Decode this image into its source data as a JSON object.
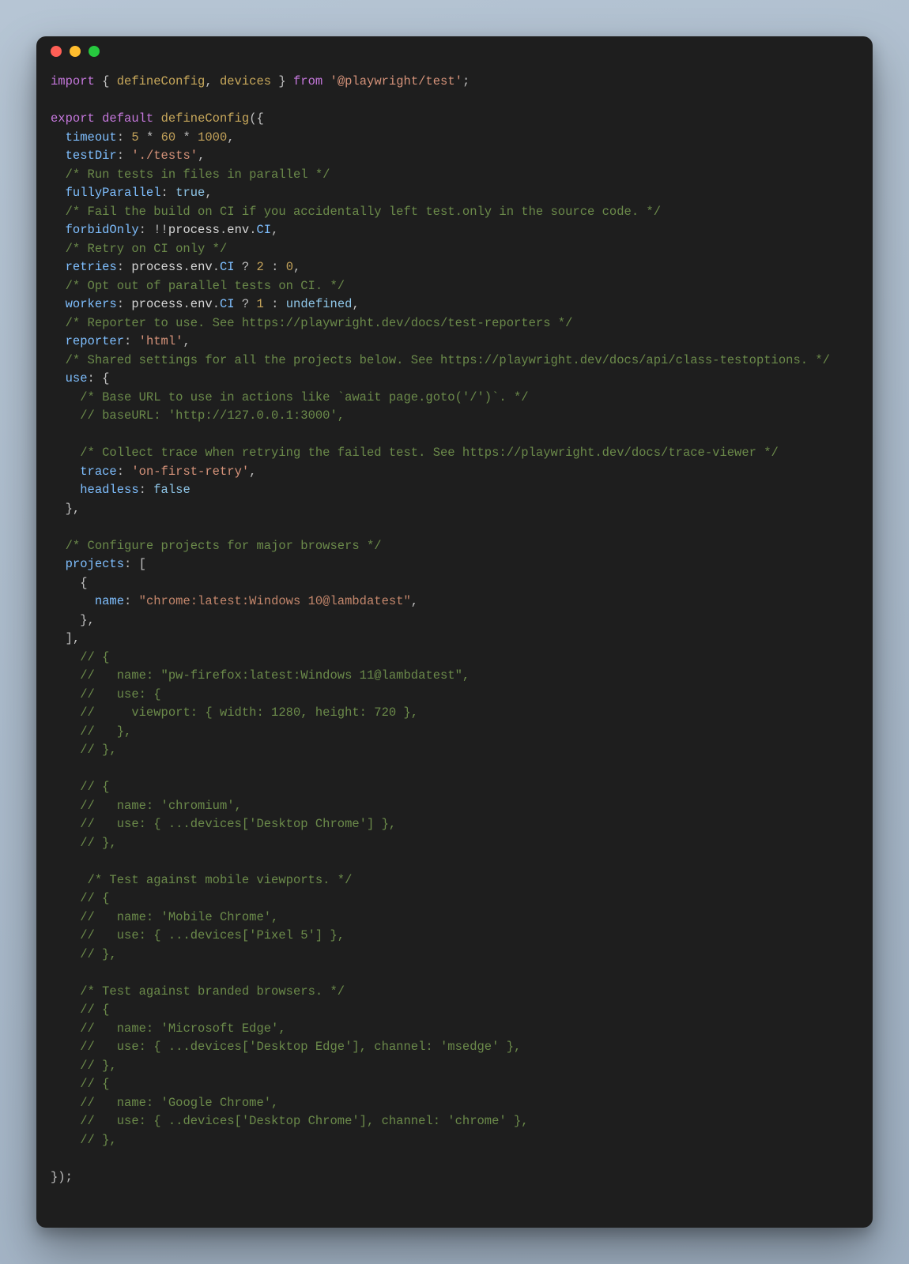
{
  "lines": [
    [
      {
        "cls": "kw",
        "t": "import"
      },
      {
        "cls": "punct",
        "t": " { "
      },
      {
        "cls": "fn",
        "t": "defineConfig"
      },
      {
        "cls": "punct",
        "t": ", "
      },
      {
        "cls": "fn",
        "t": "devices"
      },
      {
        "cls": "punct",
        "t": " } "
      },
      {
        "cls": "kw",
        "t": "from"
      },
      {
        "cls": "punct",
        "t": " "
      },
      {
        "cls": "str",
        "t": "'@playwright/test'"
      },
      {
        "cls": "punct",
        "t": ";"
      }
    ],
    [],
    [
      {
        "cls": "kw",
        "t": "export"
      },
      {
        "cls": "punct",
        "t": " "
      },
      {
        "cls": "kw",
        "t": "default"
      },
      {
        "cls": "punct",
        "t": " "
      },
      {
        "cls": "fn",
        "t": "defineConfig"
      },
      {
        "cls": "punct",
        "t": "({"
      }
    ],
    [
      {
        "cls": "punct",
        "t": "  "
      },
      {
        "cls": "prop",
        "t": "timeout"
      },
      {
        "cls": "punct",
        "t": ": "
      },
      {
        "cls": "num",
        "t": "5"
      },
      {
        "cls": "punct",
        "t": " * "
      },
      {
        "cls": "num",
        "t": "60"
      },
      {
        "cls": "punct",
        "t": " * "
      },
      {
        "cls": "num",
        "t": "1000"
      },
      {
        "cls": "punct",
        "t": ","
      }
    ],
    [
      {
        "cls": "punct",
        "t": "  "
      },
      {
        "cls": "prop",
        "t": "testDir"
      },
      {
        "cls": "punct",
        "t": ": "
      },
      {
        "cls": "str",
        "t": "'./tests'"
      },
      {
        "cls": "punct",
        "t": ","
      }
    ],
    [
      {
        "cls": "punct",
        "t": "  "
      },
      {
        "cls": "comment",
        "t": "/* Run tests in files in parallel */"
      }
    ],
    [
      {
        "cls": "punct",
        "t": "  "
      },
      {
        "cls": "prop",
        "t": "fullyParallel"
      },
      {
        "cls": "punct",
        "t": ": "
      },
      {
        "cls": "bool",
        "t": "true"
      },
      {
        "cls": "punct",
        "t": ","
      }
    ],
    [
      {
        "cls": "punct",
        "t": "  "
      },
      {
        "cls": "comment",
        "t": "/* Fail the build on CI if you accidentally left test.only in the source code. */"
      }
    ],
    [
      {
        "cls": "punct",
        "t": "  "
      },
      {
        "cls": "prop",
        "t": "forbidOnly"
      },
      {
        "cls": "punct",
        "t": ": !!"
      },
      {
        "cls": "ident",
        "t": "process"
      },
      {
        "cls": "punct",
        "t": "."
      },
      {
        "cls": "ident",
        "t": "env"
      },
      {
        "cls": "punct",
        "t": "."
      },
      {
        "cls": "env",
        "t": "CI"
      },
      {
        "cls": "punct",
        "t": ","
      }
    ],
    [
      {
        "cls": "punct",
        "t": "  "
      },
      {
        "cls": "comment",
        "t": "/* Retry on CI only */"
      }
    ],
    [
      {
        "cls": "punct",
        "t": "  "
      },
      {
        "cls": "prop",
        "t": "retries"
      },
      {
        "cls": "punct",
        "t": ": "
      },
      {
        "cls": "ident",
        "t": "process"
      },
      {
        "cls": "punct",
        "t": "."
      },
      {
        "cls": "ident",
        "t": "env"
      },
      {
        "cls": "punct",
        "t": "."
      },
      {
        "cls": "env",
        "t": "CI"
      },
      {
        "cls": "punct",
        "t": " ? "
      },
      {
        "cls": "num",
        "t": "2"
      },
      {
        "cls": "punct",
        "t": " : "
      },
      {
        "cls": "num",
        "t": "0"
      },
      {
        "cls": "punct",
        "t": ","
      }
    ],
    [
      {
        "cls": "punct",
        "t": "  "
      },
      {
        "cls": "comment",
        "t": "/* Opt out of parallel tests on CI. */"
      }
    ],
    [
      {
        "cls": "punct",
        "t": "  "
      },
      {
        "cls": "prop",
        "t": "workers"
      },
      {
        "cls": "punct",
        "t": ": "
      },
      {
        "cls": "ident",
        "t": "process"
      },
      {
        "cls": "punct",
        "t": "."
      },
      {
        "cls": "ident",
        "t": "env"
      },
      {
        "cls": "punct",
        "t": "."
      },
      {
        "cls": "env",
        "t": "CI"
      },
      {
        "cls": "punct",
        "t": " ? "
      },
      {
        "cls": "num",
        "t": "1"
      },
      {
        "cls": "punct",
        "t": " : "
      },
      {
        "cls": "bool",
        "t": "undefined"
      },
      {
        "cls": "punct",
        "t": ","
      }
    ],
    [
      {
        "cls": "punct",
        "t": "  "
      },
      {
        "cls": "comment",
        "t": "/* Reporter to use. See https://playwright.dev/docs/test-reporters */"
      }
    ],
    [
      {
        "cls": "punct",
        "t": "  "
      },
      {
        "cls": "prop",
        "t": "reporter"
      },
      {
        "cls": "punct",
        "t": ": "
      },
      {
        "cls": "str",
        "t": "'html'"
      },
      {
        "cls": "punct",
        "t": ","
      }
    ],
    [
      {
        "cls": "punct",
        "t": "  "
      },
      {
        "cls": "comment",
        "t": "/* Shared settings for all the projects below. See https://playwright.dev/docs/api/class-testoptions. */"
      }
    ],
    [
      {
        "cls": "punct",
        "t": "  "
      },
      {
        "cls": "prop",
        "t": "use"
      },
      {
        "cls": "punct",
        "t": ": {"
      }
    ],
    [
      {
        "cls": "punct",
        "t": "    "
      },
      {
        "cls": "comment",
        "t": "/* Base URL to use in actions like `await page.goto('/')`. */"
      }
    ],
    [
      {
        "cls": "punct",
        "t": "    "
      },
      {
        "cls": "comment",
        "t": "// baseURL: 'http://127.0.0.1:3000',"
      }
    ],
    [],
    [
      {
        "cls": "punct",
        "t": "    "
      },
      {
        "cls": "comment",
        "t": "/* Collect trace when retrying the failed test. See https://playwright.dev/docs/trace-viewer */"
      }
    ],
    [
      {
        "cls": "punct",
        "t": "    "
      },
      {
        "cls": "prop",
        "t": "trace"
      },
      {
        "cls": "punct",
        "t": ": "
      },
      {
        "cls": "str",
        "t": "'on-first-retry'"
      },
      {
        "cls": "punct",
        "t": ","
      }
    ],
    [
      {
        "cls": "punct",
        "t": "    "
      },
      {
        "cls": "prop",
        "t": "headless"
      },
      {
        "cls": "punct",
        "t": ": "
      },
      {
        "cls": "bool",
        "t": "false"
      }
    ],
    [
      {
        "cls": "punct",
        "t": "  },"
      }
    ],
    [],
    [
      {
        "cls": "punct",
        "t": "  "
      },
      {
        "cls": "comment",
        "t": "/* Configure projects for major browsers */"
      }
    ],
    [
      {
        "cls": "punct",
        "t": "  "
      },
      {
        "cls": "prop",
        "t": "projects"
      },
      {
        "cls": "punct",
        "t": ": ["
      }
    ],
    [
      {
        "cls": "punct",
        "t": "    {"
      }
    ],
    [
      {
        "cls": "punct",
        "t": "      "
      },
      {
        "cls": "prop",
        "t": "name"
      },
      {
        "cls": "punct",
        "t": ": "
      },
      {
        "cls": "str2",
        "t": "\"chrome:latest:Windows 10@lambdatest\""
      },
      {
        "cls": "punct",
        "t": ","
      }
    ],
    [
      {
        "cls": "punct",
        "t": "    },"
      }
    ],
    [
      {
        "cls": "punct",
        "t": "  ],"
      }
    ],
    [
      {
        "cls": "punct",
        "t": "    "
      },
      {
        "cls": "comment",
        "t": "// {"
      }
    ],
    [
      {
        "cls": "punct",
        "t": "    "
      },
      {
        "cls": "comment",
        "t": "//   name: \"pw-firefox:latest:Windows 11@lambdatest\","
      }
    ],
    [
      {
        "cls": "punct",
        "t": "    "
      },
      {
        "cls": "comment",
        "t": "//   use: {"
      }
    ],
    [
      {
        "cls": "punct",
        "t": "    "
      },
      {
        "cls": "comment",
        "t": "//     viewport: { width: 1280, height: 720 },"
      }
    ],
    [
      {
        "cls": "punct",
        "t": "    "
      },
      {
        "cls": "comment",
        "t": "//   },"
      }
    ],
    [
      {
        "cls": "punct",
        "t": "    "
      },
      {
        "cls": "comment",
        "t": "// },"
      }
    ],
    [],
    [
      {
        "cls": "punct",
        "t": "    "
      },
      {
        "cls": "comment",
        "t": "// {"
      }
    ],
    [
      {
        "cls": "punct",
        "t": "    "
      },
      {
        "cls": "comment",
        "t": "//   name: 'chromium',"
      }
    ],
    [
      {
        "cls": "punct",
        "t": "    "
      },
      {
        "cls": "comment",
        "t": "//   use: { ...devices['Desktop Chrome'] },"
      }
    ],
    [
      {
        "cls": "punct",
        "t": "    "
      },
      {
        "cls": "comment",
        "t": "// },"
      }
    ],
    [],
    [
      {
        "cls": "punct",
        "t": "     "
      },
      {
        "cls": "comment",
        "t": "/* Test against mobile viewports. */"
      }
    ],
    [
      {
        "cls": "punct",
        "t": "    "
      },
      {
        "cls": "comment",
        "t": "// {"
      }
    ],
    [
      {
        "cls": "punct",
        "t": "    "
      },
      {
        "cls": "comment",
        "t": "//   name: 'Mobile Chrome',"
      }
    ],
    [
      {
        "cls": "punct",
        "t": "    "
      },
      {
        "cls": "comment",
        "t": "//   use: { ...devices['Pixel 5'] },"
      }
    ],
    [
      {
        "cls": "punct",
        "t": "    "
      },
      {
        "cls": "comment",
        "t": "// },"
      }
    ],
    [],
    [
      {
        "cls": "punct",
        "t": "    "
      },
      {
        "cls": "comment",
        "t": "/* Test against branded browsers. */"
      }
    ],
    [
      {
        "cls": "punct",
        "t": "    "
      },
      {
        "cls": "comment",
        "t": "// {"
      }
    ],
    [
      {
        "cls": "punct",
        "t": "    "
      },
      {
        "cls": "comment",
        "t": "//   name: 'Microsoft Edge',"
      }
    ],
    [
      {
        "cls": "punct",
        "t": "    "
      },
      {
        "cls": "comment",
        "t": "//   use: { ...devices['Desktop Edge'], channel: 'msedge' },"
      }
    ],
    [
      {
        "cls": "punct",
        "t": "    "
      },
      {
        "cls": "comment",
        "t": "// },"
      }
    ],
    [
      {
        "cls": "punct",
        "t": "    "
      },
      {
        "cls": "comment",
        "t": "// {"
      }
    ],
    [
      {
        "cls": "punct",
        "t": "    "
      },
      {
        "cls": "comment",
        "t": "//   name: 'Google Chrome',"
      }
    ],
    [
      {
        "cls": "punct",
        "t": "    "
      },
      {
        "cls": "comment",
        "t": "//   use: { ..devices['Desktop Chrome'], channel: 'chrome' },"
      }
    ],
    [
      {
        "cls": "punct",
        "t": "    "
      },
      {
        "cls": "comment",
        "t": "// },"
      }
    ],
    [],
    [
      {
        "cls": "punct",
        "t": "});"
      }
    ]
  ]
}
